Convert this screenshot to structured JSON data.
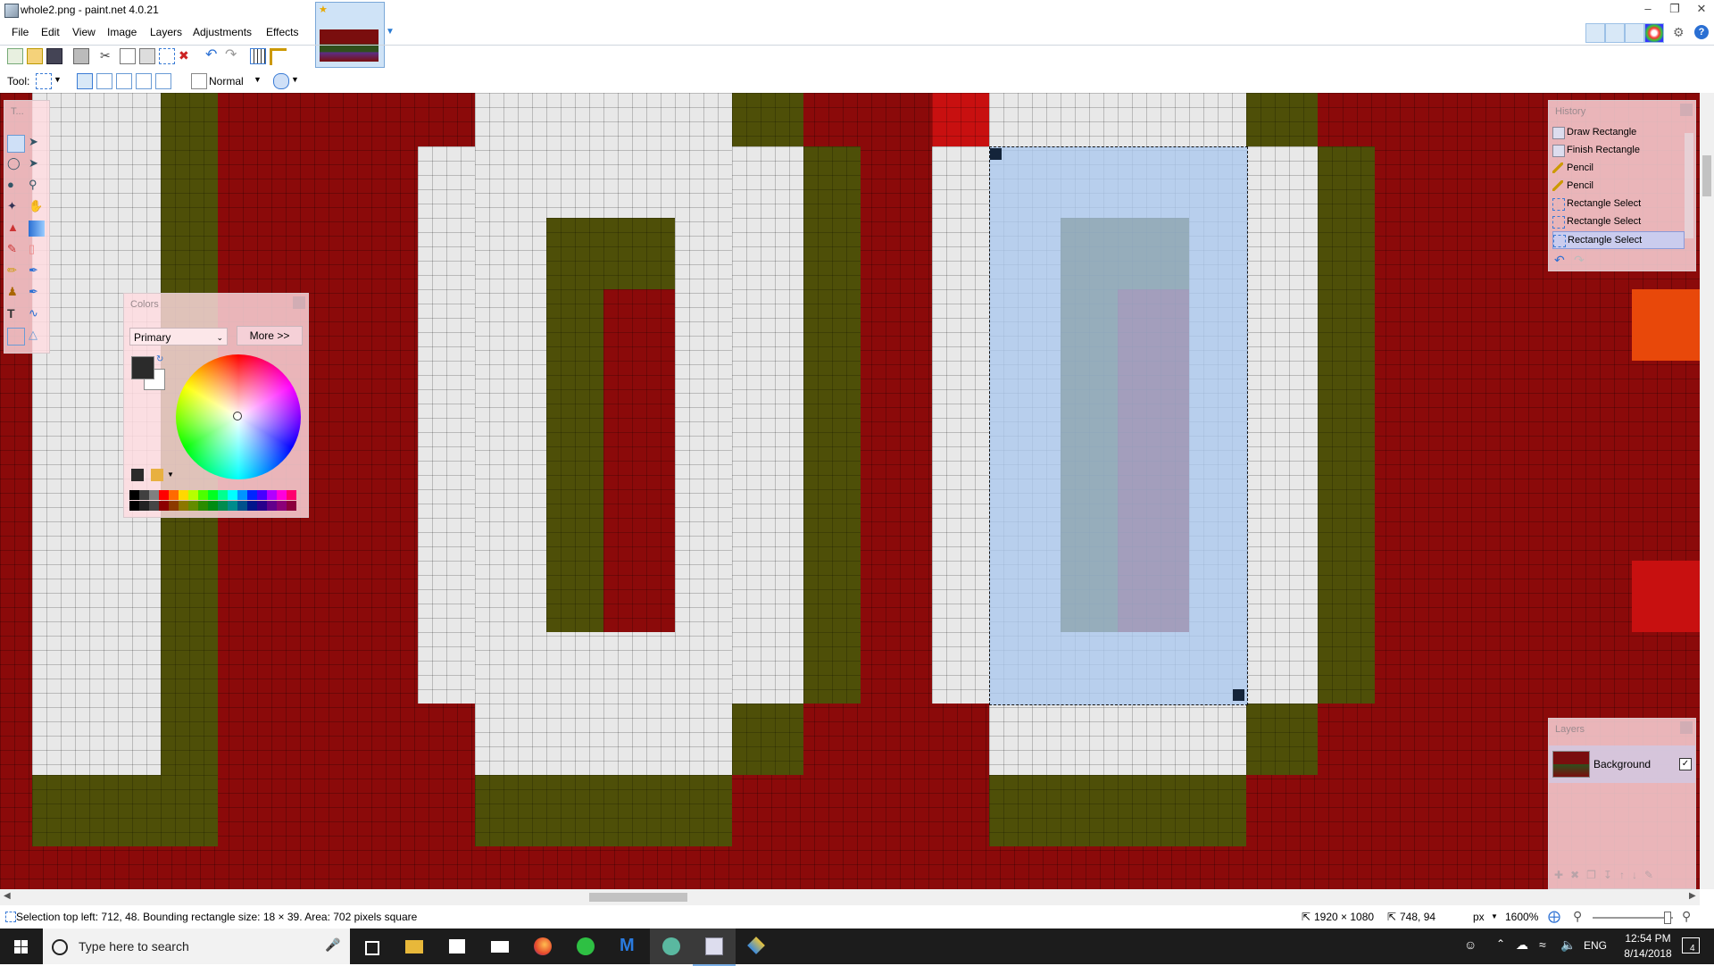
{
  "window": {
    "title": "whole2.png - paint.net 4.0.21"
  },
  "menu": {
    "items": [
      "File",
      "Edit",
      "View",
      "Image",
      "Layers",
      "Adjustments",
      "Effects"
    ]
  },
  "toolbar": {
    "tool_label": "Tool:",
    "blend_mode": "Normal"
  },
  "tools_window": {
    "title": "T..."
  },
  "colors_window": {
    "title": "Colors",
    "dropdown_value": "Primary",
    "more_button": "More >>",
    "primary_color": "#2b2b2b",
    "secondary_color": "#ffffff"
  },
  "history_window": {
    "title": "History",
    "items": [
      {
        "label": "Draw Rectangle",
        "icon": "rectangle-icon"
      },
      {
        "label": "Finish Rectangle",
        "icon": "rectangle-icon"
      },
      {
        "label": "Pencil",
        "icon": "pencil-icon"
      },
      {
        "label": "Pencil",
        "icon": "pencil-icon"
      },
      {
        "label": "Rectangle Select",
        "icon": "rectangle-select-icon"
      },
      {
        "label": "Rectangle Select",
        "icon": "rectangle-select-icon"
      },
      {
        "label": "Rectangle Select",
        "icon": "rectangle-select-icon"
      }
    ],
    "selected_index": 6
  },
  "layers_window": {
    "title": "Layers",
    "layers": [
      {
        "name": "Background",
        "visible": true
      }
    ]
  },
  "statusbar": {
    "selection_info": "Selection top left: 712, 48. Bounding rectangle size: 18 × 39. Area: 702 pixels square",
    "image_size": "1920 × 1080",
    "cursor_pos": "748, 94",
    "units": "px",
    "zoom": "1600%"
  },
  "taskbar": {
    "search_placeholder": "Type here to search",
    "language": "ENG",
    "time": "12:54 PM",
    "date": "8/14/2018",
    "notification_count": "4"
  },
  "palette_colors": [
    "#000000",
    "#404040",
    "#808080",
    "#ff0000",
    "#ff6a00",
    "#ffd800",
    "#b6ff00",
    "#4cff00",
    "#00ff21",
    "#00ff90",
    "#00ffff",
    "#0094ff",
    "#0026ff",
    "#4800ff",
    "#b200ff",
    "#ff00dc",
    "#ff006e"
  ],
  "canvas_colors": {
    "background_red": "#8b0a0a",
    "light_gray": "#e8e8e8",
    "olive": "#4e4f08",
    "bright_red": "#c81010",
    "orange": "#e8480a",
    "selection": "#aac8ee"
  }
}
